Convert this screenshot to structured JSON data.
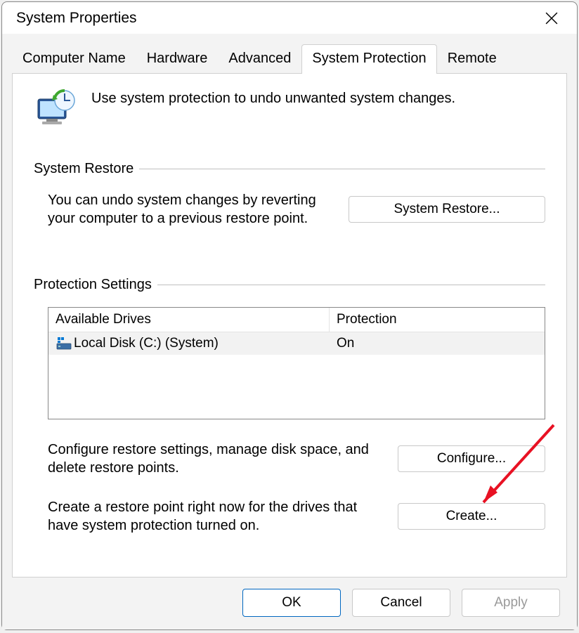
{
  "window": {
    "title": "System Properties"
  },
  "tabs": [
    {
      "label": "Computer Name"
    },
    {
      "label": "Hardware"
    },
    {
      "label": "Advanced"
    },
    {
      "label": "System Protection"
    },
    {
      "label": "Remote"
    }
  ],
  "intro_text": "Use system protection to undo unwanted system changes.",
  "groups": {
    "restore": {
      "header": "System Restore",
      "desc": "You can undo system changes by reverting your computer to a previous restore point.",
      "button": "System Restore..."
    },
    "protection": {
      "header": "Protection Settings",
      "columns": {
        "drive": "Available Drives",
        "protection": "Protection"
      },
      "rows": [
        {
          "drive": "Local Disk (C:) (System)",
          "protection": "On"
        }
      ],
      "configure_desc": "Configure restore settings, manage disk space, and delete restore points.",
      "configure_button": "Configure...",
      "create_desc": "Create a restore point right now for the drives that have system protection turned on.",
      "create_button": "Create..."
    }
  },
  "dialog_buttons": {
    "ok": "OK",
    "cancel": "Cancel",
    "apply": "Apply"
  }
}
